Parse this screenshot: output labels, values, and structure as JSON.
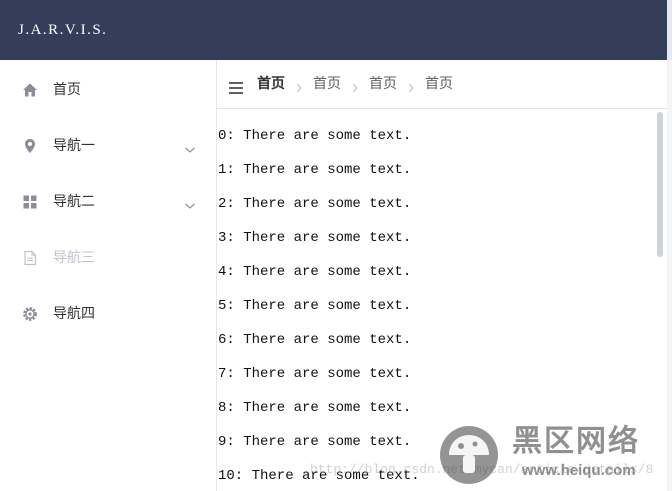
{
  "app": {
    "brand": "J.A.R.V.I.S."
  },
  "sidebar": {
    "items": [
      {
        "label": "首页",
        "icon": "home-icon",
        "has_submenu": false,
        "disabled": false
      },
      {
        "label": "导航一",
        "icon": "location-pin-icon",
        "has_submenu": true,
        "disabled": false
      },
      {
        "label": "导航二",
        "icon": "grid-icon",
        "has_submenu": true,
        "disabled": false
      },
      {
        "label": "导航三",
        "icon": "document-icon",
        "has_submenu": false,
        "disabled": true
      },
      {
        "label": "导航四",
        "icon": "gear-icon",
        "has_submenu": false,
        "disabled": false
      }
    ]
  },
  "breadcrumb": {
    "items": [
      "首页",
      "首页",
      "首页",
      "首页"
    ]
  },
  "content": {
    "lines": [
      "0: There are some text.",
      "1: There are some text.",
      "2: There are some text.",
      "3: There are some text.",
      "4: There are some text.",
      "5: There are some text.",
      "6: There are some text.",
      "7: There are some text.",
      "8: There are some text.",
      "9: There are some text.",
      "10: There are some text."
    ]
  },
  "watermark": {
    "url": "http://blog.csdn.net/mycan/article/details/8",
    "title": "黑区网络",
    "subtitle": "www.heiqu.com"
  },
  "colors": {
    "topbar": "#353e59",
    "text": "#303133",
    "disabled": "#c0c4cc",
    "border": "#e6e6e6"
  }
}
